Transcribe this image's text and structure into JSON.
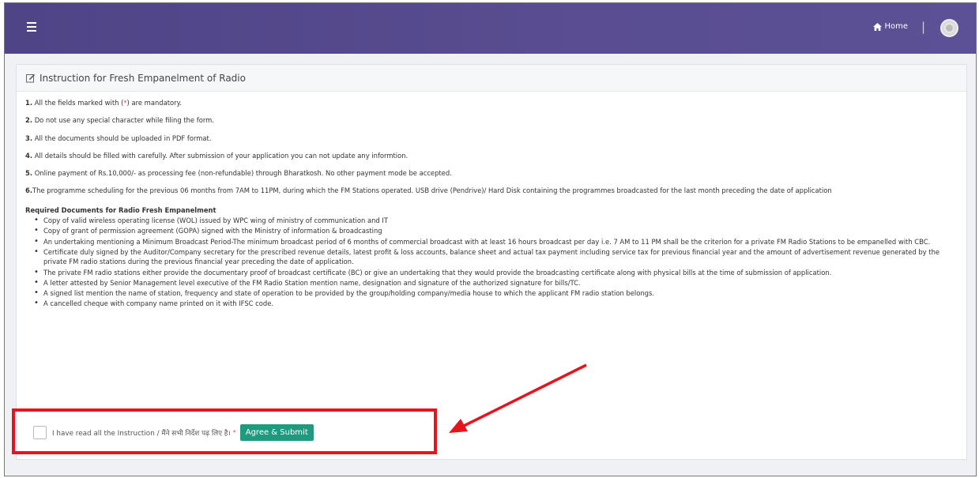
{
  "topbar": {
    "home_label": "Home",
    "divider": "|",
    "accent_color": "#574c8f"
  },
  "panel": {
    "title": "Instruction for Fresh Empanelment of Radio",
    "instructions": [
      {
        "num": "1.",
        "text_pre": "All the fields marked with (",
        "star": "*",
        "text_post": ") are mandatory."
      },
      {
        "num": "2.",
        "text": "Do not use any special character while filing the form."
      },
      {
        "num": "3.",
        "text": "All the documents should be uploaded in PDF format."
      },
      {
        "num": "4.",
        "text": "All details should be filled with carefully. After submission of your application you can not update any informtion."
      },
      {
        "num": "5.",
        "text": "Online payment of Rs.10,000/- as processing fee (non-refundable) through Bharatkosh. No other payment mode be accepted."
      },
      {
        "num": "6.",
        "text": "The programme scheduling for the previous 06 months from 7AM to 11PM, during which the FM Stations operated. USB drive (Pendrive)/ Hard Disk containing the programmes broadcasted for the last month preceding the date of application"
      }
    ],
    "docs_title": "Required Documents for Radio Fresh Empanelment",
    "docs": [
      "Copy of valid wireless operating license (WOL) issued by WPC wing of ministry of communication and IT",
      "Copy of grant of permission agreement (GOPA) signed with the Ministry of information & broadcasting",
      "An undertaking mentioning a Minimum Broadcast Period-The minimum broadcast period of 6 months of commercial broadcast with at least 16 hours broadcast per day i.e. 7 AM to 11 PM shall be the criterion for a private FM Radio Stations to be empanelled with CBC.",
      "Certificate duly signed by the Auditor/Company secretary for the prescribed revenue details, latest profit & loss accounts, balance sheet and actual tax payment including service tax for previous financial year and the amount of advertisement revenue generated by the private FM radio stations during the previous financial year preceding the date of application.",
      "The private FM radio stations either provide the documentary proof of broadcast certificate (BC) or give an undertaking that they would provide the broadcasting certificate along with physical bills at the time of submission of application.",
      "A letter attested by Senior Management level executive of the FM Radio Station mention name, designation and signature of the authorized signature for bills/TC.",
      "A signed list mention the name of station, frequency and state of operation to be provided by the group/holding company/media house to which the applicant FM radio station belongs.",
      "A cancelled cheque with company name printed on it with IFSC code."
    ],
    "agree_label": "I have read all the Instruction / मैंने सभी निर्देश पढ़ लिए है।",
    "agree_star": "*",
    "agree_button": "Agree & Submit"
  },
  "annotation": {
    "color": "#e6141c"
  }
}
